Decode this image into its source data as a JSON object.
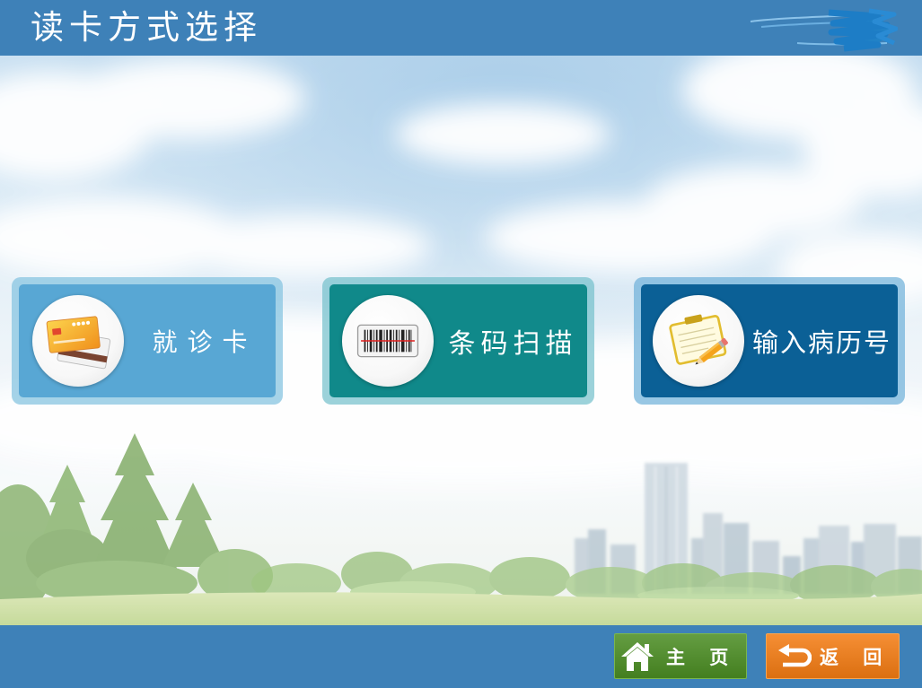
{
  "header": {
    "title": "读卡方式选择",
    "logo_icon": "redacted-logo-scribble"
  },
  "theme": {
    "bar_color": "#3e81b8",
    "text_color": "#ffffff"
  },
  "options": [
    {
      "label": "就诊卡",
      "icon": "medical-card-icon",
      "color": "#58a7d4"
    },
    {
      "label": "条码扫描",
      "icon": "barcode-scan-icon",
      "color": "#10898a"
    },
    {
      "label": "输入病历号",
      "icon": "clipboard-pencil-icon",
      "color": "#0b6096"
    }
  ],
  "footer": {
    "home_button": {
      "label": "主 页",
      "icon": "home-icon",
      "color": "#4b8d23"
    },
    "back_button": {
      "label": "返 回",
      "icon": "return-arrow-icon",
      "color": "#f47c13"
    }
  }
}
